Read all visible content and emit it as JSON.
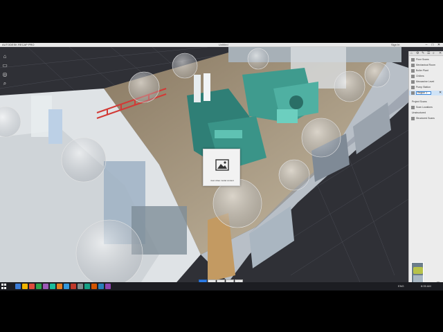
{
  "app": {
    "title": "AUTODESK RECAP PRO",
    "center_title": "Untitled",
    "user_label": "Sign In",
    "window_buttons": [
      "–",
      "□",
      "✕"
    ]
  },
  "left_toolbar": [
    {
      "name": "home-icon",
      "glyph": "⌂"
    },
    {
      "name": "monitor-icon",
      "glyph": "▭"
    },
    {
      "name": "target-icon",
      "glyph": "◎"
    },
    {
      "name": "search-icon",
      "glyph": "⌕"
    }
  ],
  "placeholder": {
    "icon": "image-icon",
    "caption": "view video model content"
  },
  "panel": {
    "tool_glyphs": [
      "⌂",
      "⚙",
      "✎",
      "☰",
      "⌕",
      "✕"
    ],
    "rows": [
      {
        "label": "Floor Scans"
      },
      {
        "label": "Mechanical Room"
      },
      {
        "label": "Boiler Plant"
      },
      {
        "label": "Chillers"
      },
      {
        "label": "Mezzanine Level"
      },
      {
        "label": "Pump Station"
      }
    ],
    "edit_value": "Region 1",
    "edit_close": "✕",
    "sections": [
      {
        "label": "Project Scans"
      },
      {
        "label": "Scan Locations"
      },
      {
        "label": "Unstructured"
      },
      {
        "label": "Structured Scans"
      }
    ],
    "toggle_glyph": "⌃"
  },
  "bottom_nav": [
    {
      "name": "view-top-button",
      "glyph": "▦",
      "active": true
    },
    {
      "name": "view-orbit-button",
      "glyph": "◐",
      "active": false
    },
    {
      "name": "view-layers-button",
      "glyph": "◫",
      "active": false
    },
    {
      "name": "view-measure-button",
      "glyph": "⊞",
      "active": false
    },
    {
      "name": "view-settings-button",
      "glyph": "⚙",
      "active": false
    }
  ],
  "taskbar": {
    "apps": [
      "#3a7bd5",
      "#f0b400",
      "#e04b3c",
      "#2ea44f",
      "#9b59b6",
      "#1abc9c",
      "#e67e22",
      "#3498db",
      "#c0392b",
      "#7f8c8d",
      "#16a085",
      "#d35400",
      "#2980b9",
      "#8e44ad"
    ],
    "tray": "ENG",
    "clock": "8:05 AM"
  },
  "colors": {
    "accent": "#2c7be5",
    "panel_bg": "#ececec",
    "scene_bg": "#2f3036"
  }
}
